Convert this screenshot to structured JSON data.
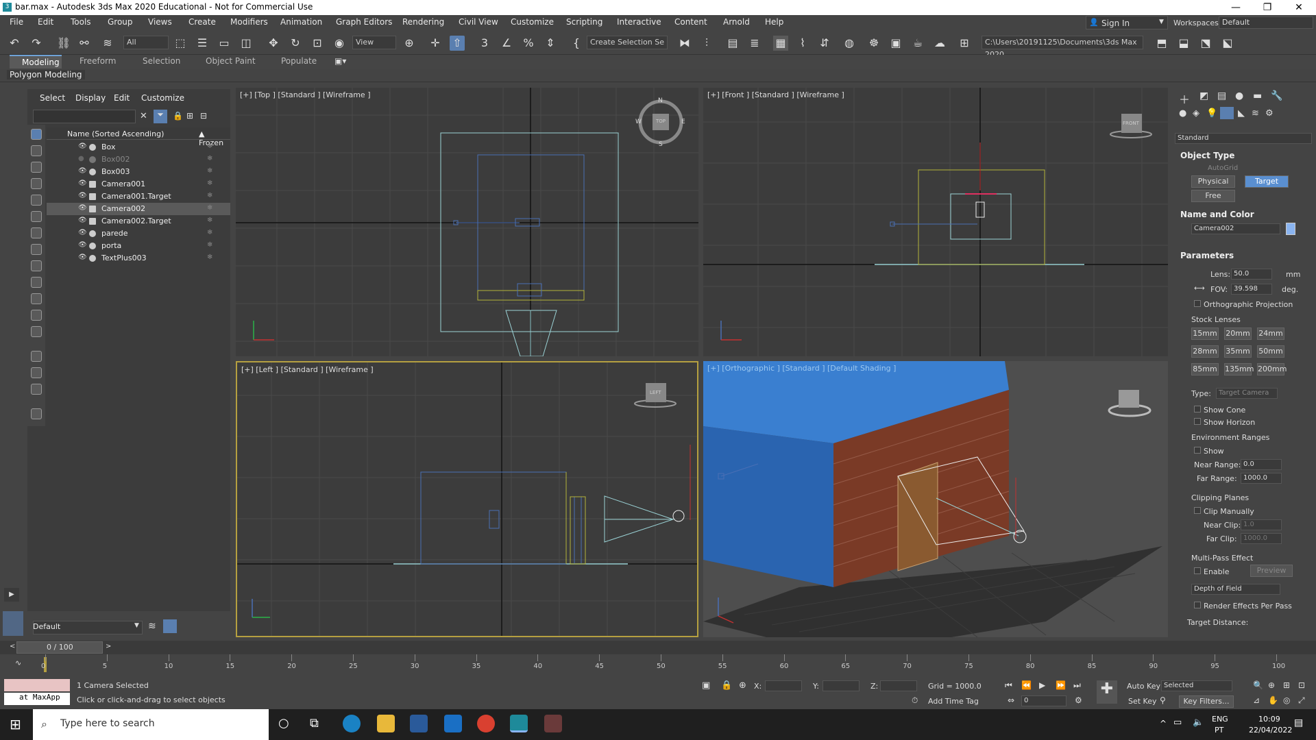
{
  "window": {
    "title": "bar.max - Autodesk 3ds Max 2020 Educational - Not for Commercial Use",
    "minimize": "—",
    "maximize": "❐",
    "close": "✕"
  },
  "menu": [
    "File",
    "Edit",
    "Tools",
    "Group",
    "Views",
    "Create",
    "Modifiers",
    "Animation",
    "Graph Editors",
    "Rendering",
    "Civil View",
    "Customize",
    "Scripting",
    "Interactive",
    "Content",
    "Arnold",
    "Help"
  ],
  "signin": "Sign In",
  "workspaces_label": "Workspaces:",
  "workspace": "Default",
  "toolbar": {
    "filter": "All",
    "view": "View",
    "selection_set": "Create Selection Se",
    "path": "C:\\Users\\20191125\\Documents\\3ds Max 2020"
  },
  "ribbon": {
    "tabs": [
      "Modeling",
      "Freeform",
      "Selection",
      "Object Paint",
      "Populate"
    ],
    "sub": "Polygon Modeling"
  },
  "explorer": {
    "menus": [
      "Select",
      "Display",
      "Edit",
      "Customize"
    ],
    "col_name": "Name (Sorted Ascending)",
    "col_frozen": "▲ Frozen",
    "items": [
      "Box",
      "Box002",
      "Box003",
      "Camera001",
      "Camera001.Target",
      "Camera002",
      "Camera002.Target",
      "parede",
      "porta",
      "TextPlus003"
    ],
    "layer": "Default"
  },
  "viewports": {
    "top": "[+] [Top ] [Standard ] [Wireframe ]",
    "front": "[+] [Front ] [Standard ] [Wireframe ]",
    "left": "[+] [Left ] [Standard ] [Wireframe ]",
    "persp": "[+] [Orthographic ] [Standard ] [Default Shading ]",
    "compass": {
      "n": "N",
      "s": "S",
      "e": "E",
      "w": "W",
      "top": "TOP"
    },
    "front_cube": "FRONT",
    "left_cube": "LEFT"
  },
  "panel": {
    "dropdown": "Standard",
    "object_type": "Object Type",
    "autogrid": "AutoGrid",
    "physical": "Physical",
    "target": "Target",
    "free": "Free",
    "name_color": "Name and Color",
    "name": "Camera002",
    "parameters": "Parameters",
    "lens_label": "Lens:",
    "lens": "50.0",
    "lens_unit": "mm",
    "fov_label": "FOV:",
    "fov": "39.598",
    "fov_unit": "deg.",
    "ortho": "Orthographic Projection",
    "stock_lenses": "Stock Lenses",
    "lenses": [
      "15mm",
      "20mm",
      "24mm",
      "28mm",
      "35mm",
      "50mm",
      "85mm",
      "135mm",
      "200mm"
    ],
    "type_label": "Type:",
    "type": "Target Camera",
    "show_cone": "Show Cone",
    "show_horizon": "Show Horizon",
    "env": "Environment Ranges",
    "show": "Show",
    "near_range_label": "Near Range:",
    "near_range": "0.0",
    "far_range_label": "Far Range:",
    "far_range": "1000.0",
    "clipping": "Clipping Planes",
    "clip_manually": "Clip Manually",
    "near_clip_label": "Near Clip:",
    "near_clip": "1.0",
    "far_clip_label": "Far Clip:",
    "far_clip": "1000.0",
    "multipass": "Multi-Pass Effect",
    "enable": "Enable",
    "preview": "Preview",
    "dof": "Depth of Field",
    "render_per_pass": "Render Effects Per Pass",
    "target_distance": "Target Distance:"
  },
  "timeline": {
    "frame": "0 / 100",
    "ticks": [
      "0",
      "5",
      "10",
      "15",
      "20",
      "25",
      "30",
      "35",
      "40",
      "45",
      "50",
      "55",
      "60",
      "65",
      "70",
      "75",
      "80",
      "85",
      "90",
      "95",
      "100"
    ]
  },
  "status": {
    "maxscript": "at MaxApp",
    "selected": "1 Camera Selected",
    "prompt": "Click or click-and-drag to select objects",
    "x": "X:",
    "y": "Y:",
    "z": "Z:",
    "grid": "Grid = 1000.0",
    "add_time_tag": "Add Time Tag",
    "autokey": "Auto Key",
    "setkey": "Set Key",
    "selected_dd": "Selected",
    "key_filters": "Key Filters...",
    "frame_field": "0"
  },
  "taskbar": {
    "search": "Type here to search",
    "lang": "ENG",
    "layout": "PT",
    "time": "10:09",
    "date": "22/04/2022"
  }
}
